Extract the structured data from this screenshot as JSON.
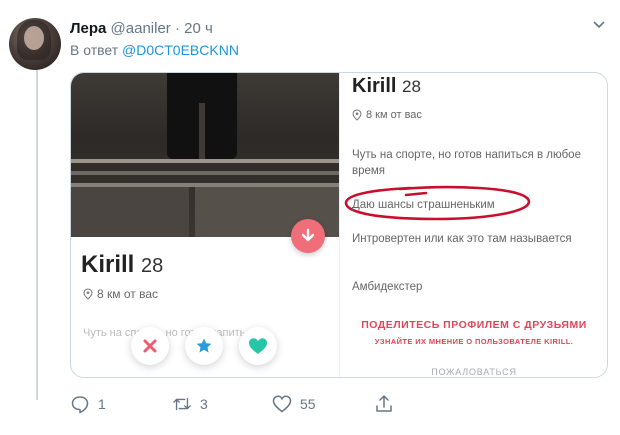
{
  "tweet": {
    "author_name": "Лера",
    "handle": "@aaniler",
    "separator": "·",
    "time": "20 ч",
    "reply_prefix": "В ответ",
    "reply_mention": "@D0CT0EBCKNN"
  },
  "profile_card": {
    "name": "Kirill",
    "age": "28",
    "distance": "8 км от вас",
    "bio_preview": "Чуть на спорте, но готов напиться в",
    "buttons": [
      "close-icon",
      "star-icon",
      "heart-icon"
    ]
  },
  "profile_detail": {
    "name": "Kirill",
    "age": "28",
    "distance": "8 км от вас",
    "line1": "Чуть на спорте, но готов напиться в любое время",
    "line2": "Даю шансы страшненьким",
    "line3": "Интровертен или как это там называется",
    "line4": "Амбидекстер",
    "share_label": "ПОДЕЛИТЕСЬ ПРОФИЛЕМ С ДРУЗЬЯМИ",
    "share_sub": "УЗНАЙТЕ ИХ МНЕНИЕ О ПОЛЬЗОВАТЕЛЕ KIRILL.",
    "report_label": "ПОЖАЛОВАТЬСЯ"
  },
  "actions": {
    "replies": "1",
    "retweets": "3",
    "likes": "55"
  },
  "colors": {
    "mention": "#1b95e0",
    "tinder_red": "#e2455b",
    "highlight_circle": "#c8102e"
  }
}
